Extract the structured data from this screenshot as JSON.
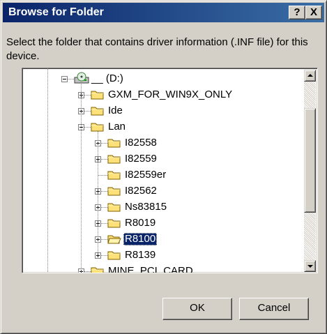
{
  "dialog": {
    "title": "Browse for Folder",
    "help_label": "?",
    "close_label": "X",
    "instruction": "Select the folder that contains driver information (.INF file) for this device."
  },
  "tree": {
    "nodes": [
      {
        "label": "__ (D:)",
        "icon": "cd-drive-icon",
        "expander": "minus",
        "level": 0
      },
      {
        "label": "GXM_FOR_WIN9X_ONLY",
        "icon": "folder-icon",
        "expander": "plus",
        "level": 1
      },
      {
        "label": "Ide",
        "icon": "folder-icon",
        "expander": "plus",
        "level": 1
      },
      {
        "label": "Lan",
        "icon": "folder-icon",
        "expander": "minus",
        "level": 1
      },
      {
        "label": "I82558",
        "icon": "folder-icon",
        "expander": "plus",
        "level": 2
      },
      {
        "label": "I82559",
        "icon": "folder-icon",
        "expander": "plus",
        "level": 2
      },
      {
        "label": "I82559er",
        "icon": "folder-icon",
        "expander": "none",
        "level": 2
      },
      {
        "label": "I82562",
        "icon": "folder-icon",
        "expander": "plus",
        "level": 2
      },
      {
        "label": "Ns83815",
        "icon": "folder-icon",
        "expander": "plus",
        "level": 2
      },
      {
        "label": "R8019",
        "icon": "folder-icon",
        "expander": "plus",
        "level": 2
      },
      {
        "label": "R8100",
        "icon": "open-folder-icon",
        "expander": "plus",
        "level": 2,
        "selected": true
      },
      {
        "label": "R8139",
        "icon": "folder-icon",
        "expander": "plus",
        "level": 2
      },
      {
        "label": "MINE_PCI_CARD",
        "icon": "folder-icon",
        "expander": "plus",
        "level": 1
      }
    ]
  },
  "buttons": {
    "ok_label": "OK",
    "cancel_label": "Cancel"
  },
  "colors": {
    "title_bar": "#0a246a",
    "selection": "#0a246a",
    "face": "#d4d0c8",
    "folder": "#ffe17a"
  }
}
